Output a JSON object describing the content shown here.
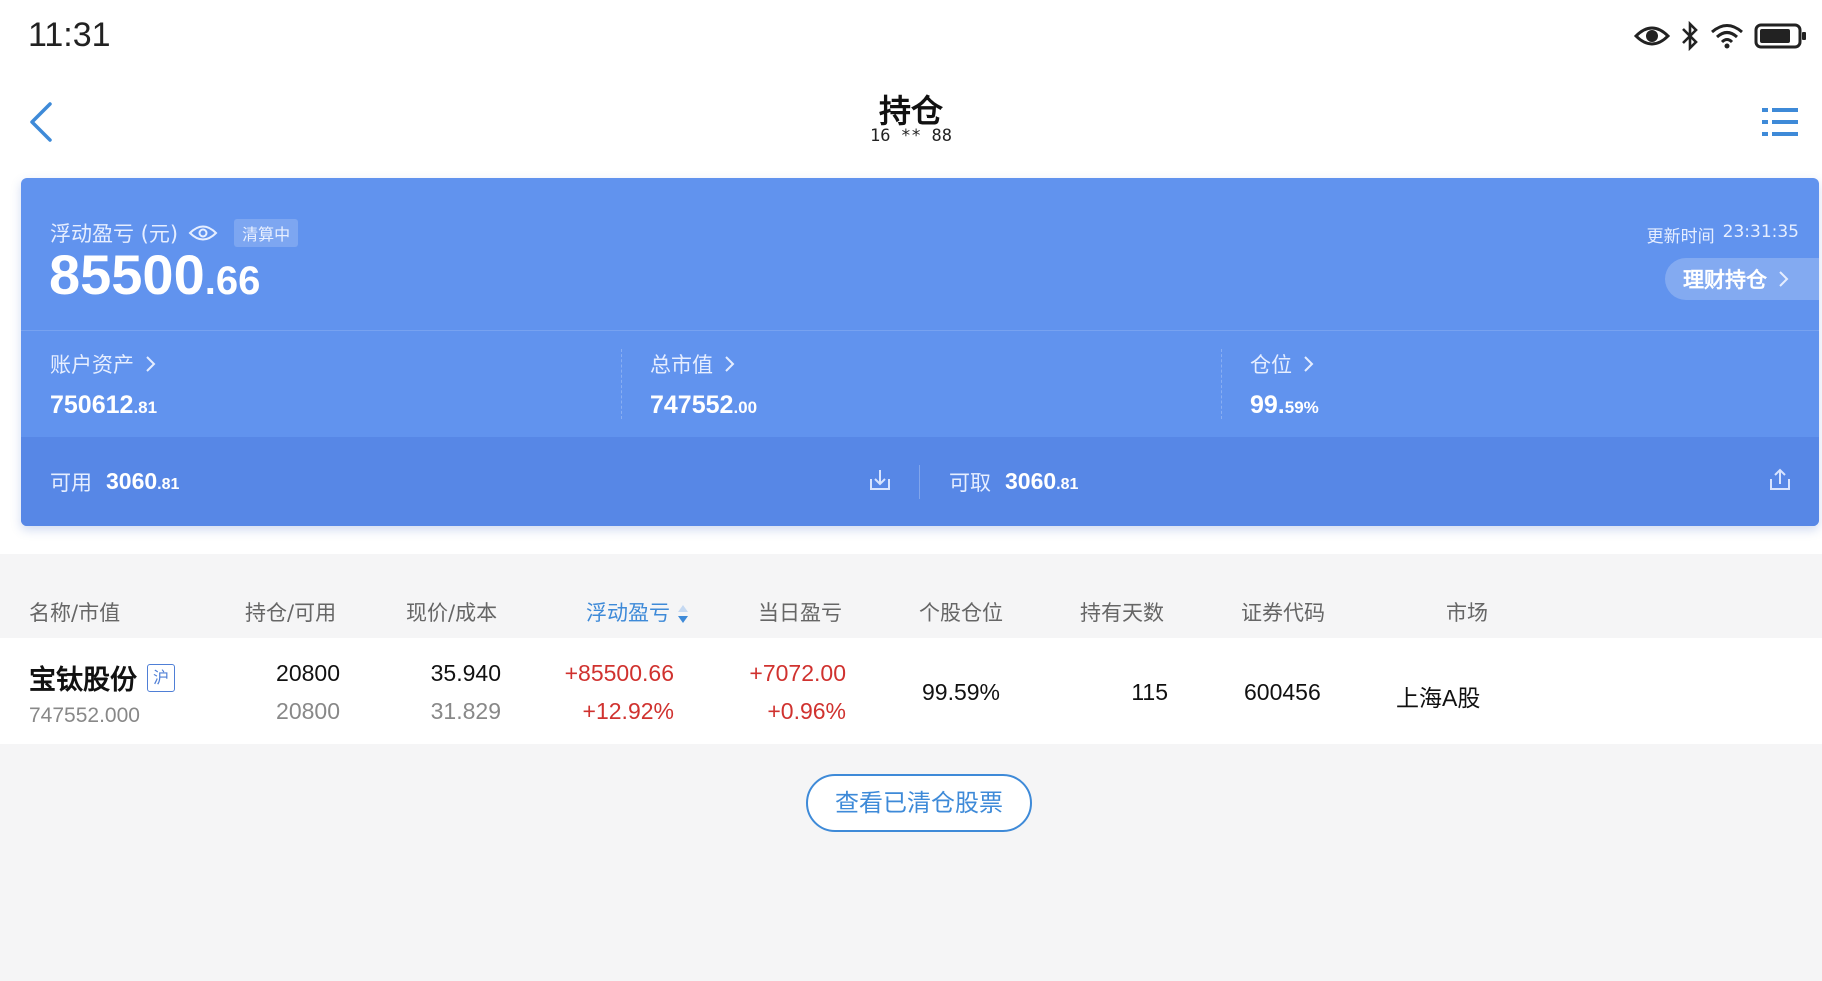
{
  "status_bar": {
    "time": "11:31",
    "icons": [
      "eye-icon",
      "bluetooth-icon",
      "wifi-icon",
      "battery-icon"
    ]
  },
  "nav": {
    "title": "持仓",
    "subtitle": "16 ** 88",
    "back_icon": "chevron-left-icon",
    "menu_icon": "list-menu-icon"
  },
  "summary": {
    "floating_pl_label": "浮动盈亏 (元)",
    "clearing_badge": "清算中",
    "floating_pl_int": "85500",
    "floating_pl_dec": ".66",
    "update_label": "更新时间",
    "update_time": "23:31:35",
    "finance_button": "理财持仓",
    "account_assets_label": "账户资产",
    "account_assets_int": "750612",
    "account_assets_dec": ".81",
    "market_value_label": "总市值",
    "market_value_int": "747552",
    "market_value_dec": ".00",
    "position_label": "仓位",
    "position_int": "99.",
    "position_dec": "59%",
    "available_label": "可用",
    "available_int": "3060",
    "available_dec": ".81",
    "withdrawable_label": "可取",
    "withdrawable_int": "3060",
    "withdrawable_dec": ".81"
  },
  "table": {
    "headers": [
      "名称/市值",
      "持仓/可用",
      "现价/成本",
      "浮动盈亏",
      "当日盈亏",
      "个股仓位",
      "持有天数",
      "证券代码",
      "市场"
    ],
    "sorted_column": "浮动盈亏",
    "rows": [
      {
        "name": "宝钛股份",
        "market_tag": "沪",
        "market_value": "747552.000",
        "holding": "20800",
        "available": "20800",
        "price": "35.940",
        "cost": "31.829",
        "floating_pl": "+85500.66",
        "floating_pl_pct": "+12.92%",
        "daily_pl": "+7072.00",
        "daily_pl_pct": "+0.96%",
        "position_pct": "99.59%",
        "days_held": "115",
        "code": "600456",
        "market": "上海A股"
      }
    ]
  },
  "clear_button": "查看已清仓股票",
  "colors": {
    "card_blue": "#6193ee",
    "accent_blue": "#3e8ad8",
    "profit_red": "#d0322f"
  }
}
